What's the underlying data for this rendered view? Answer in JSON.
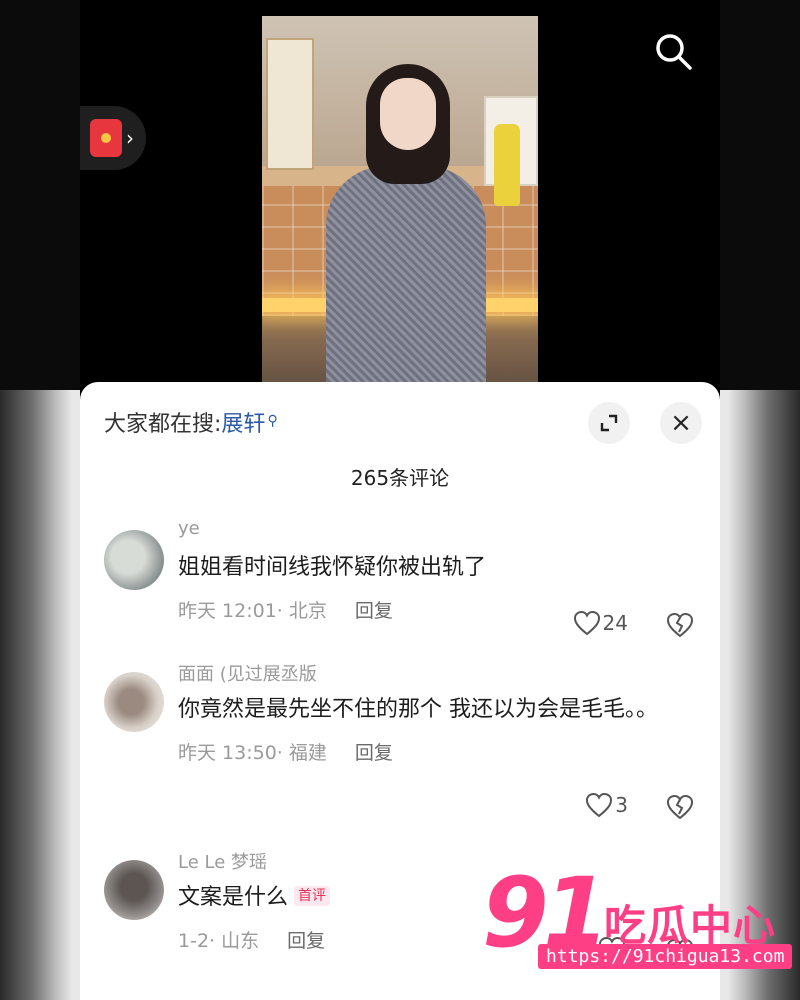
{
  "video": {
    "redpacket_icon": "red-envelope-icon",
    "redpacket_arrow": "›",
    "search_icon": "search-icon"
  },
  "sheet": {
    "search_prefix": "大家都在搜:",
    "search_term": "展轩",
    "search_glass": "⚲",
    "expand_icon": "expand-icon",
    "close_label": "×",
    "comment_count": "265条评论"
  },
  "comments": [
    {
      "username": "ye",
      "text": "姐姐看时间线我怀疑你被出轨了",
      "badge": "",
      "time_location": "昨天 12:01· 北京",
      "reply": "回复",
      "likes": "24"
    },
    {
      "username": "面面 (见过展丞版",
      "text": "你竟然是最先坐不住的那个 我还以为会是毛毛。。",
      "badge": "",
      "time_location": "昨天 13:50· 福建",
      "reply": "回复",
      "likes": "3"
    },
    {
      "username": "Le Le 梦瑶",
      "text": "文案是什么",
      "badge": "首评",
      "time_location": "1-2· 山东",
      "reply": "回复",
      "likes": ""
    }
  ],
  "watermark": {
    "number": "91",
    "name": "吃瓜中心",
    "url": "https://91chigua13.com"
  },
  "colors": {
    "accent_blue": "#2a5aa8",
    "badge_pink": "#e5335b",
    "watermark_pink": "#ff3f85"
  }
}
